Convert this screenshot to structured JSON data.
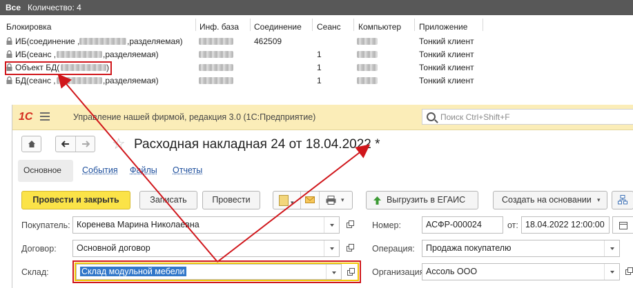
{
  "locks_window": {
    "filter": "Все",
    "count_label": "Количество: 4",
    "columns": [
      "Блокировка",
      "Инф. база",
      "Соединение",
      "Сеанс",
      "Компьютер",
      "Приложение"
    ],
    "rows": [
      {
        "lock_pre": "ИБ(соединение ,",
        "lock_post": ",разделяемая)",
        "connection": "462509",
        "session": "",
        "app": "Тонкий клиент"
      },
      {
        "lock_pre": "ИБ(сеанс ,",
        "lock_post": ",разделяемая)",
        "connection": "",
        "session": "1",
        "app": "Тонкий клиент"
      },
      {
        "lock_pre": "Объект БД(",
        "lock_post": ")",
        "connection": "",
        "session": "1",
        "app": "Тонкий клиент"
      },
      {
        "lock_pre": "БД(сеанс ,",
        "lock_post": ",разделяемая)",
        "connection": "",
        "session": "1",
        "app": "Тонкий клиент"
      }
    ]
  },
  "app": {
    "logo": "1С",
    "title": "Управление нашей фирмой, редакция 3.0  (1С:Предприятие)",
    "search_placeholder": "Поиск Ctrl+Shift+F",
    "doc_title": "Расходная накладная 24 от 18.04.2022 *",
    "tabs": [
      "Основное",
      "События",
      "Файлы",
      "Отчеты"
    ],
    "buttons": {
      "post_close": "Провести и закрыть",
      "save": "Записать",
      "post": "Провести",
      "egais": "Выгрузить в ЕГАИС",
      "create_based": "Создать на основании"
    },
    "form": {
      "buyer_label": "Покупатель:",
      "buyer_value": "Коренева Марина Николаевна",
      "contract_label": "Договор:",
      "contract_value": "Основной договор",
      "warehouse_label": "Склад:",
      "warehouse_value": "Склад модульной мебели",
      "number_label": "Номер:",
      "number_value": "АСФР-000024",
      "date_label": "от:",
      "date_value": "18.04.2022 12:00:00",
      "operation_label": "Операция:",
      "operation_value": "Продажа покупателю",
      "org_label": "Организация:",
      "org_value": "Ассоль ООО"
    }
  },
  "colors": {
    "annotation": "#d0161b",
    "accent": "#fbe348",
    "selection": "#3277c9"
  }
}
